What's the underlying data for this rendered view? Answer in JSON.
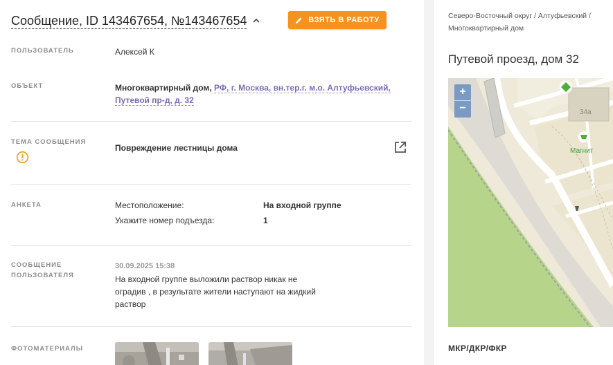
{
  "header": {
    "title": "Сообщение, ID 143467654, №143467654",
    "take_button": "ВЗЯТЬ В РАБОТУ"
  },
  "fields": {
    "user_label": "ПОЛЬЗОВАТЕЛЬ",
    "user_value": "Алексей К",
    "object_label": "ОБЪЕКТ",
    "object_type": "Многоквартирный дом,",
    "object_address_line1": "РФ, г. Москва, вн.тер.г. м.о. Алтуфьевский,",
    "object_address_line2": "Путевой пр-д, д. 32",
    "topic_label": "ТЕМА СООБЩЕНИЯ",
    "topic_value": "Повреждение лестницы дома",
    "survey_label": "АНКЕТА",
    "survey_rows": [
      {
        "question": "Местоположение:",
        "answer": "На входной группе"
      },
      {
        "question": "Укажите номер подъезда:",
        "answer": "1"
      }
    ],
    "message_label_line1": "СООБЩЕНИЕ",
    "message_label_line2": "ПОЛЬЗОВАТЕЛЯ",
    "message_date": "30.09.2025 15:38",
    "message_line1": "На входной группе выложили раствор никак не",
    "message_line2": "оградив , в результате жители наступают на жидкий",
    "message_line3": "раствор",
    "photos_label": "ФОТОМАТЕРИАЛЫ"
  },
  "aside": {
    "breadcrumb_line1": "Северо-Восточный округ / Алтуфьевский /",
    "breadcrumb_line2": "Многоквартирный дом",
    "address_title": "Путевой проезд, дом 32",
    "map": {
      "zoom_in": "+",
      "zoom_out": "−",
      "building_label": "34а",
      "poi_label": "Магнит"
    },
    "section_label": "МКР/ДКР/ФКР"
  },
  "colors": {
    "accent": "#f6921e",
    "link": "#7c6bb5",
    "warning": "#f0a024",
    "map_green": "#b7d58a"
  },
  "icons": {
    "take_button": "pencil-icon",
    "collapse": "chevron-up-icon",
    "topic_status": "warning-circle-icon",
    "open_external": "external-link-icon"
  }
}
